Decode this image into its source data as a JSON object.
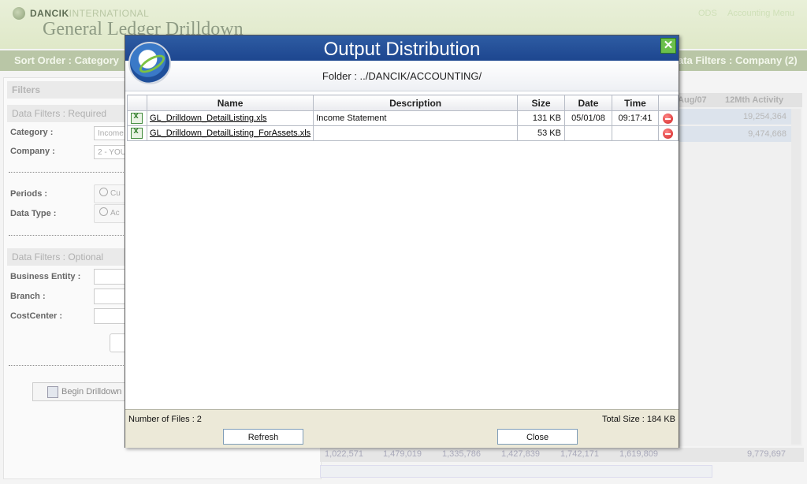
{
  "app": {
    "brand_bold": "DANCIK",
    "brand_light": "INTERNATIONAL",
    "title": "General Ledger Drilldown",
    "top_links": [
      "ODS",
      "Accounting Menu"
    ],
    "sort_order": "Sort Order : Category",
    "data_filters_right": "ata Filters : Company (2)"
  },
  "filters": {
    "header": "Filters",
    "required_header": "Data Filters : Required",
    "category_label": "Category :",
    "category_value": "Income",
    "company_label": "Company :",
    "company_value": "2 - YOU",
    "periods_label": "Periods :",
    "periods_value": "Cu",
    "datatype_label": "Data Type :",
    "datatype_value": "Ac",
    "optional_header": "Data Filters : Optional",
    "business_entity_label": "Business Entity :",
    "branch_label": "Branch :",
    "costcenter_label": "CostCenter :",
    "begin_drilldown": "Begin Drilldown"
  },
  "background_grid": {
    "col_aug": "Aug/07",
    "col_12mth": "12Mth Activity",
    "row1_value": "19,254,364",
    "row2_value": "9,474,668",
    "bottom_values": [
      "1,022,571",
      "1,479,019",
      "1,335,786",
      "1,427,839",
      "1,742,171",
      "1,619,809",
      "9,779,697"
    ]
  },
  "modal": {
    "title": "Output Distribution",
    "folder": "Folder : ../DANCIK/ACCOUNTING/",
    "columns": [
      "Name",
      "Description",
      "Size",
      "Date",
      "Time"
    ],
    "rows": [
      {
        "name": "GL_Drilldown_DetailListing.xls",
        "description": "Income Statement",
        "size": "131 KB",
        "date": "05/01/08",
        "time": "09:17:41"
      },
      {
        "name": "GL_Drilldown_DetailListing_ForAssets.xls",
        "description": "",
        "size": "53 KB",
        "date": "",
        "time": ""
      }
    ],
    "file_count": "Number of Files : 2",
    "total_size": "Total Size : 184 KB",
    "refresh_label": "Refresh",
    "close_label": "Close",
    "close_icon": "close-x-icon"
  }
}
